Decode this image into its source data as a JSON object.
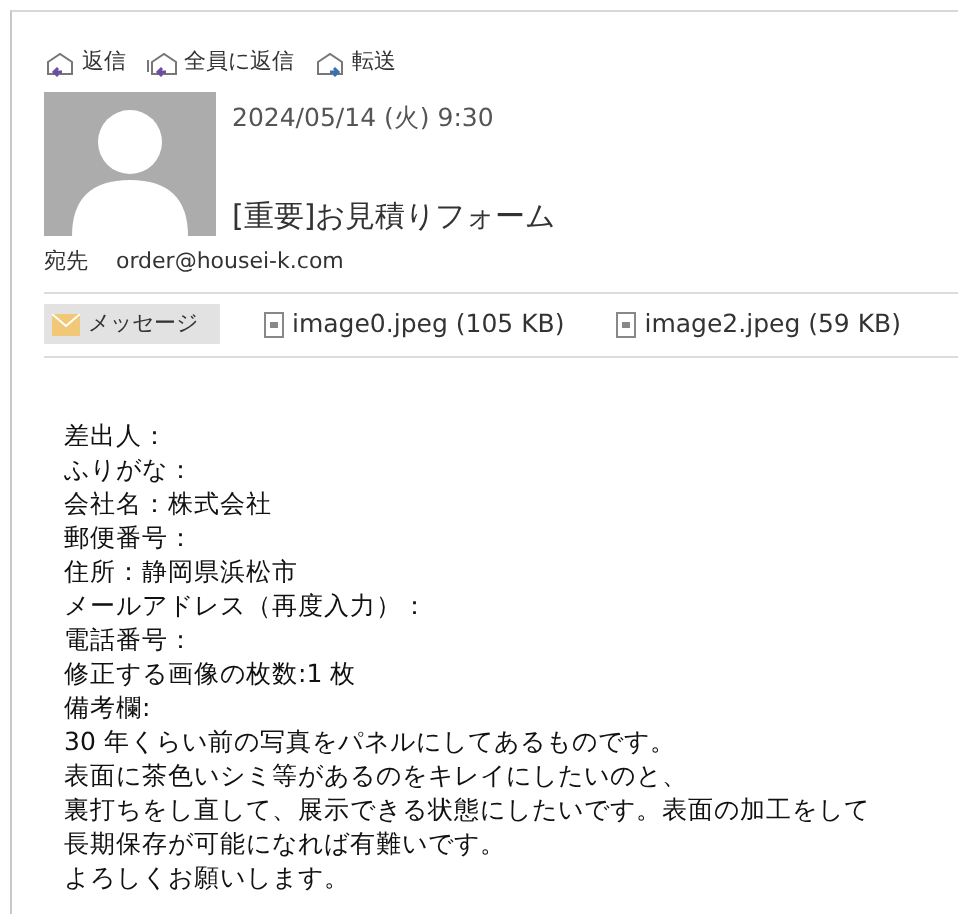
{
  "toolbar": [
    {
      "kind": "reply",
      "label": "返信"
    },
    {
      "kind": "reply_all",
      "label": "全員に返信"
    },
    {
      "kind": "forward",
      "label": "転送"
    }
  ],
  "header": {
    "date": "2024/05/14 (火) 9:30",
    "subject": "[重要]お見積りフォーム",
    "to_label": "宛先",
    "to": "order@housei-k.com"
  },
  "attachments": [
    {
      "kind": "message",
      "label": "メッセージ",
      "selected": true
    },
    {
      "kind": "file",
      "label": "image0.jpeg (105 KB)",
      "selected": false
    },
    {
      "kind": "file",
      "label": "image2.jpeg (59 KB)",
      "selected": false
    }
  ],
  "body": [
    "差出人：",
    "ふりがな：",
    "会社名：株式会社",
    "郵便番号：",
    "住所：静岡県浜松市",
    "メールアドレス（再度入力）：",
    "電話番号：",
    "修正する画像の枚数:1 枚",
    "備考欄:",
    "30 年くらい前の写真をパネルにしてあるものです。",
    "表面に茶色いシミ等があるのをキレイにしたいのと、",
    "裏打ちをし直して、展示できる状態にしたいです。表面の加工をして",
    "長期保存が可能になれば有難いです。",
    "よろしくお願いします。"
  ]
}
